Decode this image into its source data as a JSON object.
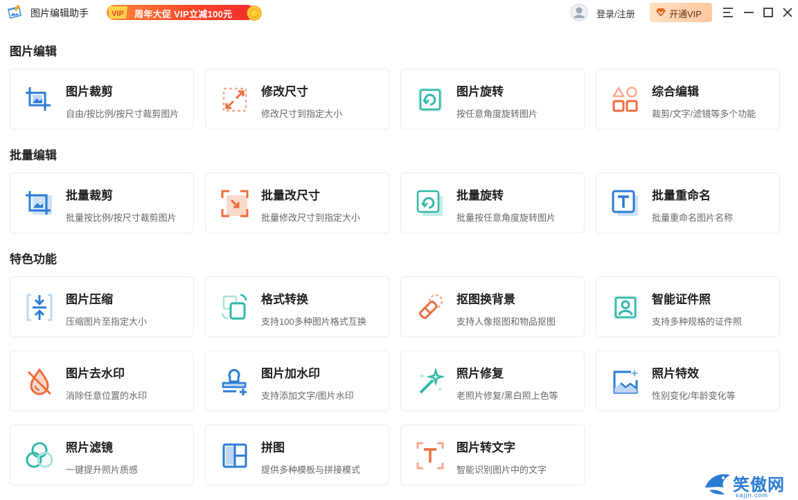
{
  "app": {
    "title": "图片编辑助手"
  },
  "promo": {
    "badge": "VIP",
    "text": "周年大促 VIP立减100元"
  },
  "header": {
    "login_label": "登录/注册",
    "vip_label": "开通VIP"
  },
  "colors": {
    "blue": "#2a7bd5",
    "orange": "#ef6b3b",
    "teal": "#2eb8a8",
    "promo": "#ff4a2b"
  },
  "sections": [
    {
      "title": "图片编辑",
      "cards": [
        {
          "icon": "crop-icon",
          "title": "图片裁剪",
          "desc": "自由/按比例/按尺寸裁剪图片"
        },
        {
          "icon": "resize-icon",
          "title": "修改尺寸",
          "desc": "修改尺寸到指定大小"
        },
        {
          "icon": "rotate-icon",
          "title": "图片旋转",
          "desc": "按任意角度旋转图片"
        },
        {
          "icon": "shapes-icon",
          "title": "综合编辑",
          "desc": "裁剪/文字/滤镜等多个功能"
        }
      ]
    },
    {
      "title": "批量编辑",
      "cards": [
        {
          "icon": "batch-crop-icon",
          "title": "批量裁剪",
          "desc": "批量按比例/按尺寸裁剪图片"
        },
        {
          "icon": "batch-resize-icon",
          "title": "批量改尺寸",
          "desc": "批量修改尺寸到指定大小"
        },
        {
          "icon": "batch-rotate-icon",
          "title": "批量旋转",
          "desc": "批量按任意角度旋转图片"
        },
        {
          "icon": "batch-rename-icon",
          "title": "批量重命名",
          "desc": "批量重命名图片名称"
        }
      ]
    },
    {
      "title": "特色功能",
      "cards": [
        {
          "icon": "compress-icon",
          "title": "图片压缩",
          "desc": "压缩图片至指定大小"
        },
        {
          "icon": "format-convert-icon",
          "title": "格式转换",
          "desc": "支持100多种图片格式互换"
        },
        {
          "icon": "eraser-icon",
          "title": "抠图换背景",
          "desc": "支持人像抠图和物品抠图"
        },
        {
          "icon": "id-photo-icon",
          "title": "智能证件照",
          "desc": "支持多种规格的证件照"
        },
        {
          "icon": "remove-watermark-icon",
          "title": "图片去水印",
          "desc": "消除任意位置的水印"
        },
        {
          "icon": "add-watermark-icon",
          "title": "图片加水印",
          "desc": "支持添加文字/图片水印"
        },
        {
          "icon": "magic-wand-icon",
          "title": "照片修复",
          "desc": "老照片修复/黑白照上色等"
        },
        {
          "icon": "photo-effect-icon",
          "title": "照片特效",
          "desc": "性别变化/年龄变化等"
        },
        {
          "icon": "filter-icon",
          "title": "照片滤镜",
          "desc": "一键提升照片质感"
        },
        {
          "icon": "collage-icon",
          "title": "拼图",
          "desc": "提供多种模板与拼接模式"
        },
        {
          "icon": "ocr-text-icon",
          "title": "图片转文字",
          "desc": "智能识别图片中的文字"
        }
      ]
    }
  ],
  "watermark": {
    "text": "笑傲网",
    "sub": "xajjn.com"
  }
}
